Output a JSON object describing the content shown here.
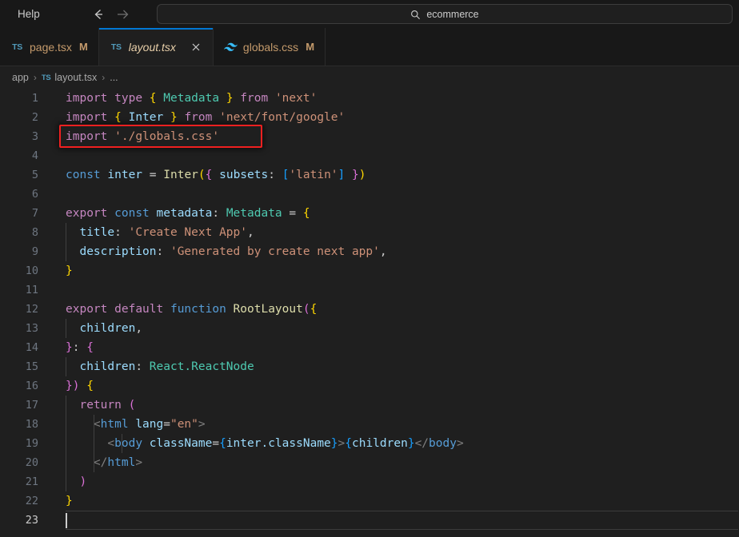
{
  "titlebar": {
    "menu_label": "Help",
    "back_icon": "arrow-left-icon",
    "forward_icon": "arrow-right-icon",
    "search_icon": "search-icon",
    "command_value": "ecommerce"
  },
  "tabs": [
    {
      "icon": "typescript-icon",
      "label": "page.tsx",
      "modifier": "M",
      "active": false,
      "closable": false
    },
    {
      "icon": "typescript-icon",
      "label": "layout.tsx",
      "modifier": "",
      "active": true,
      "closable": true,
      "close_icon": "close-icon"
    },
    {
      "icon": "tailwindcss-icon",
      "label": "globals.css",
      "modifier": "M",
      "active": false,
      "closable": false
    }
  ],
  "breadcrumbs": {
    "items": [
      "app",
      "layout.tsx",
      "..."
    ],
    "separator": "›",
    "file_icon": "typescript-icon"
  },
  "editor": {
    "language": "typescript-react",
    "current_line": 23,
    "annotation": {
      "type": "red-highlight-box",
      "target_line": 3,
      "target_text": "import './globals.css'",
      "color": "#f02020"
    },
    "lines": [
      {
        "n": 1,
        "text": "import type { Metadata } from 'next'"
      },
      {
        "n": 2,
        "text": "import { Inter } from 'next/font/google'"
      },
      {
        "n": 3,
        "text": "import './globals.css'"
      },
      {
        "n": 4,
        "text": ""
      },
      {
        "n": 5,
        "text": "const inter = Inter({ subsets: ['latin'] })"
      },
      {
        "n": 6,
        "text": ""
      },
      {
        "n": 7,
        "text": "export const metadata: Metadata = {"
      },
      {
        "n": 8,
        "text": "  title: 'Create Next App',"
      },
      {
        "n": 9,
        "text": "  description: 'Generated by create next app',"
      },
      {
        "n": 10,
        "text": "}"
      },
      {
        "n": 11,
        "text": ""
      },
      {
        "n": 12,
        "text": "export default function RootLayout({"
      },
      {
        "n": 13,
        "text": "  children,"
      },
      {
        "n": 14,
        "text": "}: {"
      },
      {
        "n": 15,
        "text": "  children: React.ReactNode"
      },
      {
        "n": 16,
        "text": "}) {"
      },
      {
        "n": 17,
        "text": "  return ("
      },
      {
        "n": 18,
        "text": "    <html lang=\"en\">"
      },
      {
        "n": 19,
        "text": "      <body className={inter.className}>{children}</body>"
      },
      {
        "n": 20,
        "text": "    </html>"
      },
      {
        "n": 21,
        "text": "  )"
      },
      {
        "n": 22,
        "text": "}"
      },
      {
        "n": 23,
        "text": ""
      }
    ]
  },
  "colors": {
    "editor_background": "#1f1f1f",
    "chrome_background": "#181818",
    "active_tab_border": "#0078d4",
    "annotation": "#f02020",
    "line_number": "#6e7681"
  }
}
